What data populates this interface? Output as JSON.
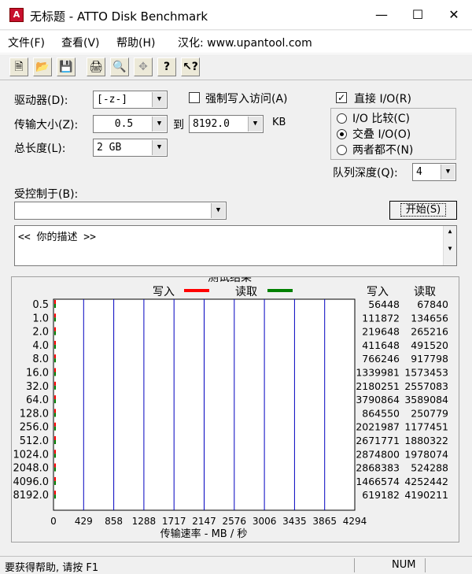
{
  "window": {
    "title": "无标题 - ATTO Disk Benchmark",
    "icon_name": "atto-app-icon",
    "controls": [
      "minimize-icon",
      "maximize-icon",
      "close-icon"
    ]
  },
  "menu": {
    "items": [
      "文件(F)",
      "查看(V)",
      "帮助(H)",
      "汉化: www.upantool.com"
    ]
  },
  "toolbar": {
    "icons": [
      "new-file-icon",
      "open-folder-icon",
      "save-icon",
      "print-icon",
      "print-preview-icon",
      "move-icon",
      "help-icon",
      "context-help-icon"
    ]
  },
  "settings": {
    "drive_label": "驱动器(D):",
    "drive_value": "[-z-]",
    "force_write_label": "强制写入访问(A)",
    "force_write_checked": false,
    "direct_io_label": "直接 I/O(R)",
    "direct_io_checked": true,
    "transfer_label": "传输大小(Z):",
    "transfer_from": "0.5",
    "to_label": "到",
    "transfer_to": "8192.0",
    "kb_label": "KB",
    "length_label": "总长度(L):",
    "length_value": "2 GB",
    "io_options": [
      {
        "label": "I/O 比较(C)",
        "selected": false
      },
      {
        "label": "交叠 I/O(O)",
        "selected": true
      },
      {
        "label": "两者都不(N)",
        "selected": false
      }
    ],
    "queue_label": "队列深度(Q):",
    "queue_value": "4",
    "controlled_by_label": "受控制于(B):",
    "controlled_by_value": "",
    "start_label": "开始(S)",
    "description": "<<  你的描述   >>"
  },
  "results": {
    "group_title": "测试结果",
    "legend_write": "写入",
    "legend_read": "读取",
    "col_write": "写入",
    "col_read": "读取",
    "write_color": "#ff0000",
    "read_color": "#008000",
    "grid_color": "#0000c0"
  },
  "chart_data": {
    "type": "bar",
    "orientation": "horizontal",
    "categories": [
      "0.5",
      "1.0",
      "2.0",
      "4.0",
      "8.0",
      "16.0",
      "32.0",
      "64.0",
      "128.0",
      "256.0",
      "512.0",
      "1024.0",
      "2048.0",
      "4096.0",
      "8192.0"
    ],
    "series": [
      {
        "name": "写入",
        "values": [
          56448,
          111872,
          219648,
          411648,
          766246,
          1339981,
          2180251,
          3790864,
          864550,
          2021987,
          2671771,
          2874800,
          2868383,
          1466574,
          619182
        ]
      },
      {
        "name": "读取",
        "values": [
          67840,
          134656,
          265216,
          491520,
          917798,
          1573453,
          2557083,
          3589084,
          250779,
          1177451,
          1880322,
          1978074,
          524288,
          4252442,
          4190211
        ]
      }
    ],
    "xlabel": "传输速率 - MB / 秒",
    "xticks": [
      "0",
      "429",
      "858",
      "1288",
      "1717",
      "2147",
      "2576",
      "3006",
      "3435",
      "3865",
      "4294"
    ],
    "xlim": [
      0,
      4294
    ],
    "grid": true,
    "legend": "top"
  },
  "status": {
    "help_text": "要获得帮助, 请按 F1",
    "num_indicator": "NUM"
  }
}
